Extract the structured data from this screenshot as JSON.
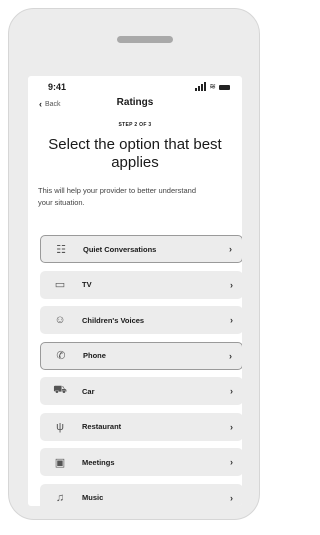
{
  "status_bar": {
    "time": "9:41",
    "icons": [
      "signal-icon",
      "wifi-icon",
      "battery-icon"
    ]
  },
  "nav": {
    "back_label": "Back",
    "title": "Ratings"
  },
  "step": "STEP 2 OF 3",
  "heading": "Select the option that best applies",
  "description": "This will help your provider to better understand your situation.",
  "options": [
    {
      "label": "Quiet Conversations",
      "icon": "conversation-icon",
      "glyph": "☷",
      "selected": true
    },
    {
      "label": "TV",
      "icon": "tv-icon",
      "glyph": "▭",
      "selected": false
    },
    {
      "label": "Children's Voices",
      "icon": "children-icon",
      "glyph": "☺",
      "selected": false
    },
    {
      "label": "Phone",
      "icon": "phone-icon",
      "glyph": "✆",
      "selected": true
    },
    {
      "label": "Car",
      "icon": "car-icon",
      "glyph": "⛟",
      "selected": false
    },
    {
      "label": "Restaurant",
      "icon": "restaurant-icon",
      "glyph": "ψ",
      "selected": false
    },
    {
      "label": "Meetings",
      "icon": "meetings-icon",
      "glyph": "▣",
      "selected": false
    },
    {
      "label": "Music",
      "icon": "music-icon",
      "glyph": "♫",
      "selected": false
    }
  ],
  "colors": {
    "option_bg": "#ececec",
    "selected_border": "#9a9a9a",
    "device_bg": "#ececec"
  }
}
